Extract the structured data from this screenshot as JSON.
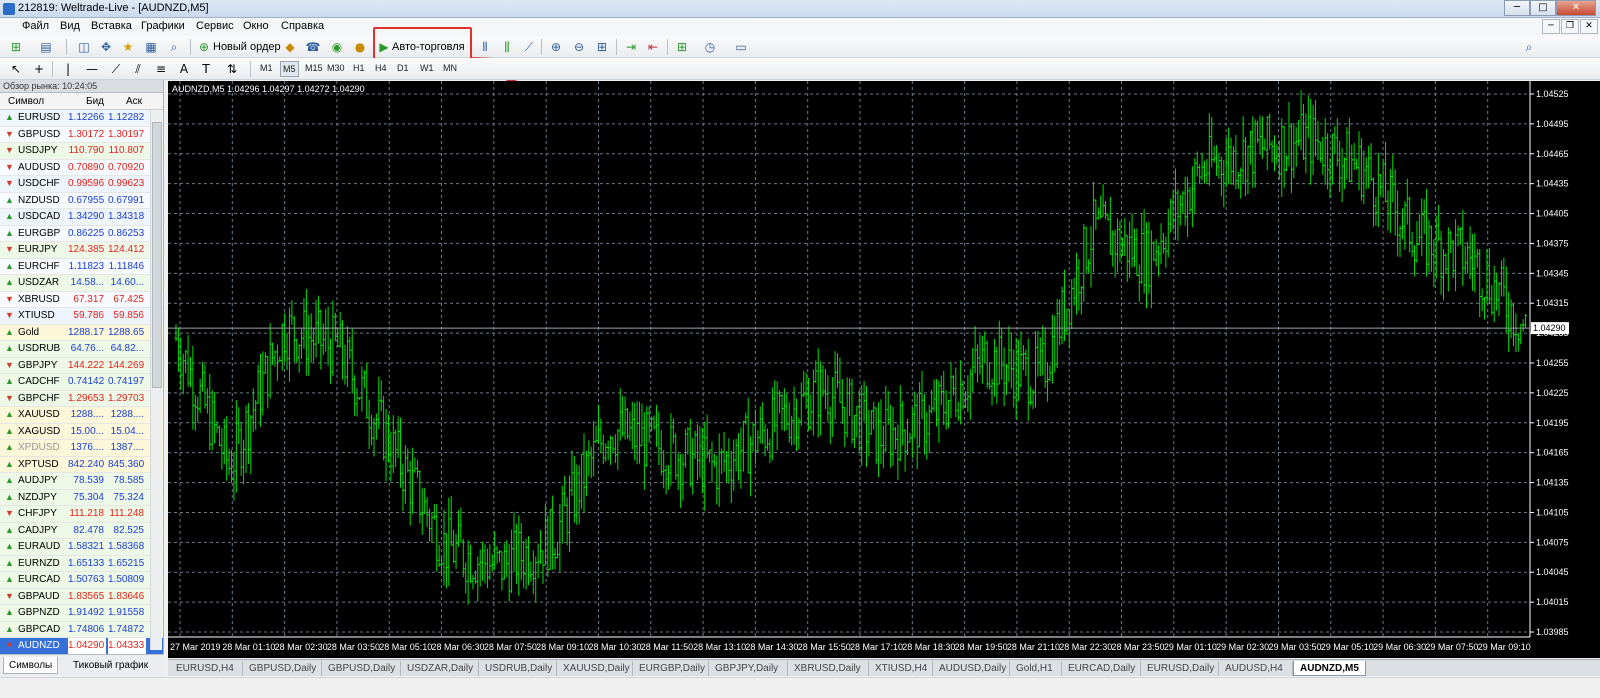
{
  "window": {
    "title": "212819: Weltrade-Live - [AUDNZD,M5]"
  },
  "menu": [
    "Файл",
    "Вид",
    "Вставка",
    "Графики",
    "Сервис",
    "Окно",
    "Справка"
  ],
  "toolbar": {
    "new_order": "Новый ордер",
    "auto_trading": "Авто-торговля"
  },
  "timeframes": [
    "M1",
    "M5",
    "M15",
    "M30",
    "H1",
    "H4",
    "D1",
    "W1",
    "MN"
  ],
  "active_timeframe": "M5",
  "market_watch": {
    "header": "Обзор рынка: 10:24:05",
    "col_symbol": "Символ",
    "col_bid": "Бид",
    "col_ask": "Аск",
    "rows": [
      {
        "symbol": "EURUSD",
        "bid": "1.12266",
        "ask": "1.12282",
        "dir": "up"
      },
      {
        "symbol": "GBPUSD",
        "bid": "1.30172",
        "ask": "1.30197",
        "dir": "dn"
      },
      {
        "symbol": "USDJPY",
        "bid": "110.790",
        "ask": "110.807",
        "dir": "dn"
      },
      {
        "symbol": "AUDUSD",
        "bid": "0.70890",
        "ask": "0.70920",
        "dir": "dn"
      },
      {
        "symbol": "USDCHF",
        "bid": "0.99596",
        "ask": "0.99623",
        "dir": "dn"
      },
      {
        "symbol": "NZDUSD",
        "bid": "0.67955",
        "ask": "0.67991",
        "dir": "up"
      },
      {
        "symbol": "USDCAD",
        "bid": "1.34290",
        "ask": "1.34318",
        "dir": "up"
      },
      {
        "symbol": "EURGBP",
        "bid": "0.86225",
        "ask": "0.86253",
        "dir": "up"
      },
      {
        "symbol": "EURJPY",
        "bid": "124.385",
        "ask": "124.412",
        "dir": "dn"
      },
      {
        "symbol": "EURCHF",
        "bid": "1.11823",
        "ask": "1.11846",
        "dir": "up"
      },
      {
        "symbol": "USDZAR",
        "bid": "14.58...",
        "ask": "14.60...",
        "dir": "up"
      },
      {
        "symbol": "XBRUSD",
        "bid": "67.317",
        "ask": "67.425",
        "dir": "dn"
      },
      {
        "symbol": "XTIUSD",
        "bid": "59.786",
        "ask": "59.856",
        "dir": "dn"
      },
      {
        "symbol": "Gold",
        "bid": "1288.17",
        "ask": "1288.65",
        "dir": "up"
      },
      {
        "symbol": "USDRUB",
        "bid": "64.76...",
        "ask": "64.82...",
        "dir": "up"
      },
      {
        "symbol": "GBPJPY",
        "bid": "144.222",
        "ask": "144.269",
        "dir": "dn"
      },
      {
        "symbol": "CADCHF",
        "bid": "0.74142",
        "ask": "0.74197",
        "dir": "up"
      },
      {
        "symbol": "GBPCHF",
        "bid": "1.29653",
        "ask": "1.29703",
        "dir": "dn"
      },
      {
        "symbol": "XAUUSD",
        "bid": "1288....",
        "ask": "1288....",
        "dir": "up"
      },
      {
        "symbol": "XAGUSD",
        "bid": "15.00...",
        "ask": "15.04...",
        "dir": "up"
      },
      {
        "symbol": "XPDUSD",
        "bid": "1376....",
        "ask": "1387....",
        "dir": "up"
      },
      {
        "symbol": "XPTUSD",
        "bid": "842.240",
        "ask": "845.360",
        "dir": "up"
      },
      {
        "symbol": "AUDJPY",
        "bid": "78.539",
        "ask": "78.585",
        "dir": "up"
      },
      {
        "symbol": "NZDJPY",
        "bid": "75.304",
        "ask": "75.324",
        "dir": "up"
      },
      {
        "symbol": "CHFJPY",
        "bid": "111.218",
        "ask": "111.248",
        "dir": "dn"
      },
      {
        "symbol": "CADJPY",
        "bid": "82.478",
        "ask": "82.525",
        "dir": "up"
      },
      {
        "symbol": "EURAUD",
        "bid": "1.58321",
        "ask": "1.58368",
        "dir": "up"
      },
      {
        "symbol": "EURNZD",
        "bid": "1.65133",
        "ask": "1.65215",
        "dir": "up"
      },
      {
        "symbol": "EURCAD",
        "bid": "1.50763",
        "ask": "1.50809",
        "dir": "up"
      },
      {
        "symbol": "GBPAUD",
        "bid": "1.83565",
        "ask": "1.83646",
        "dir": "dn"
      },
      {
        "symbol": "GBPNZD",
        "bid": "1.91492",
        "ask": "1.91558",
        "dir": "up"
      },
      {
        "symbol": "GBPCAD",
        "bid": "1.74806",
        "ask": "1.74872",
        "dir": "up"
      },
      {
        "symbol": "AUDNZD",
        "bid": "1.04290",
        "ask": "1.04333",
        "dir": "dn"
      }
    ],
    "tabs": [
      "Символы",
      "Тиковый график"
    ]
  },
  "chart": {
    "legend": "AUDNZD,M5  1.04296 1.04297 1.04272 1.04290",
    "current_price": "1.04290",
    "y_ticks": [
      "1.04525",
      "1.04495",
      "1.04465",
      "1.04435",
      "1.04405",
      "1.04375",
      "1.04345",
      "1.04315",
      "1.04285",
      "1.04255",
      "1.04225",
      "1.04195",
      "1.04165",
      "1.04135",
      "1.04105",
      "1.04075",
      "1.04045",
      "1.04015",
      "1.03985"
    ],
    "x_ticks": [
      "27 Mar 2019",
      "28 Mar 01:10",
      "28 Mar 02:30",
      "28 Mar 03:50",
      "28 Mar 05:10",
      "28 Mar 06:30",
      "28 Mar 07:50",
      "28 Mar 09:10",
      "28 Mar 10:30",
      "28 Mar 11:50",
      "28 Mar 13:10",
      "28 Mar 14:30",
      "28 Mar 15:50",
      "28 Mar 17:10",
      "28 Mar 18:30",
      "28 Mar 19:50",
      "28 Mar 21:10",
      "28 Mar 22:30",
      "28 Mar 23:50",
      "29 Mar 01:10",
      "29 Mar 02:30",
      "29 Mar 03:50",
      "29 Mar 05:10",
      "29 Mar 06:30",
      "29 Mar 07:50",
      "29 Mar 09:10"
    ],
    "bg_color": "#000000",
    "grid_color": "#6a7a88",
    "bar_color": "#00e000"
  },
  "chart_tabs": [
    "EURUSD,H4",
    "GBPUSD,Daily",
    "GBPUSD,Daily",
    "USDZAR,Daily",
    "USDRUB,Daily",
    "XAUUSD,Daily",
    "EURGBP,Daily",
    "GBPJPY,Daily",
    "XBRUSD,Daily",
    "XTIUSD,H4",
    "AUDUSD,Daily",
    "Gold,H1",
    "EURCAD,Daily",
    "EURUSD,Daily",
    "AUDUSD,H4",
    "AUDNZD,M5"
  ],
  "active_chart_tab": "AUDNZD,M5",
  "chart_data": {
    "type": "line",
    "title": "AUDNZD,M5",
    "x": [
      "27 Mar 2019",
      "28 Mar 01:10",
      "28 Mar 02:30",
      "28 Mar 03:50",
      "28 Mar 05:10",
      "28 Mar 06:30",
      "28 Mar 07:50",
      "28 Mar 09:10",
      "28 Mar 10:30",
      "28 Mar 11:50",
      "28 Mar 13:10",
      "28 Mar 14:30",
      "28 Mar 15:50",
      "28 Mar 17:10",
      "28 Mar 18:30",
      "28 Mar 19:50",
      "28 Mar 21:10",
      "28 Mar 22:30",
      "28 Mar 23:50",
      "29 Mar 01:10",
      "29 Mar 02:30",
      "29 Mar 03:50",
      "29 Mar 05:10",
      "29 Mar 06:30",
      "29 Mar 07:50",
      "29 Mar 09:10"
    ],
    "series": [
      {
        "values": [
          1.0428,
          1.0415,
          1.0429,
          1.0427,
          1.0417,
          1.0407,
          1.0405,
          1.0408,
          1.0419,
          1.0417,
          1.0415,
          1.0419,
          1.0423,
          1.0418,
          1.042,
          1.0426,
          1.0424,
          1.0439,
          1.0436,
          1.0445,
          1.0447,
          1.0448,
          1.0445,
          1.0438,
          1.0436,
          1.0429
        ]
      }
    ],
    "ylim": [
      1.0398,
      1.0453
    ],
    "grid": true
  }
}
